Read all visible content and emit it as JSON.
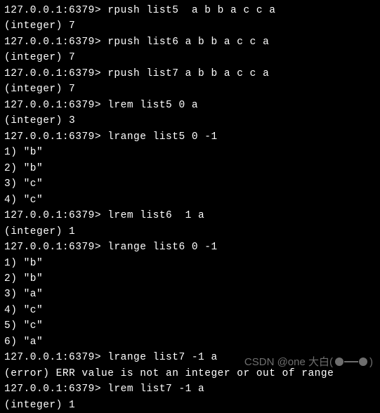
{
  "terminal": {
    "prompt": "127.0.0.1:6379> ",
    "lines": [
      {
        "type": "cmd",
        "text": "rpush list5  a b b a c c a"
      },
      {
        "type": "out",
        "text": "(integer) 7"
      },
      {
        "type": "cmd",
        "text": "rpush list6 a b b a c c a"
      },
      {
        "type": "out",
        "text": "(integer) 7"
      },
      {
        "type": "cmd",
        "text": "rpush list7 a b b a c c a"
      },
      {
        "type": "out",
        "text": "(integer) 7"
      },
      {
        "type": "cmd",
        "text": "lrem list5 0 a"
      },
      {
        "type": "out",
        "text": "(integer) 3"
      },
      {
        "type": "cmd",
        "text": "lrange list5 0 -1"
      },
      {
        "type": "out",
        "text": "1) \"b\""
      },
      {
        "type": "out",
        "text": "2) \"b\""
      },
      {
        "type": "out",
        "text": "3) \"c\""
      },
      {
        "type": "out",
        "text": "4) \"c\""
      },
      {
        "type": "cmd",
        "text": "lrem list6  1 a"
      },
      {
        "type": "out",
        "text": "(integer) 1"
      },
      {
        "type": "cmd",
        "text": "lrange list6 0 -1"
      },
      {
        "type": "out",
        "text": "1) \"b\""
      },
      {
        "type": "out",
        "text": "2) \"b\""
      },
      {
        "type": "out",
        "text": "3) \"a\""
      },
      {
        "type": "out",
        "text": "4) \"c\""
      },
      {
        "type": "out",
        "text": "5) \"c\""
      },
      {
        "type": "out",
        "text": "6) \"a\""
      },
      {
        "type": "cmd",
        "text": "lrange list7 -1 a"
      },
      {
        "type": "out",
        "text": "(error) ERR value is not an integer or out of range"
      },
      {
        "type": "cmd",
        "text": "lrem list7 -1 a"
      },
      {
        "type": "out",
        "text": "(integer) 1"
      }
    ]
  },
  "watermark": {
    "text": "CSDN @one 大白("
  }
}
